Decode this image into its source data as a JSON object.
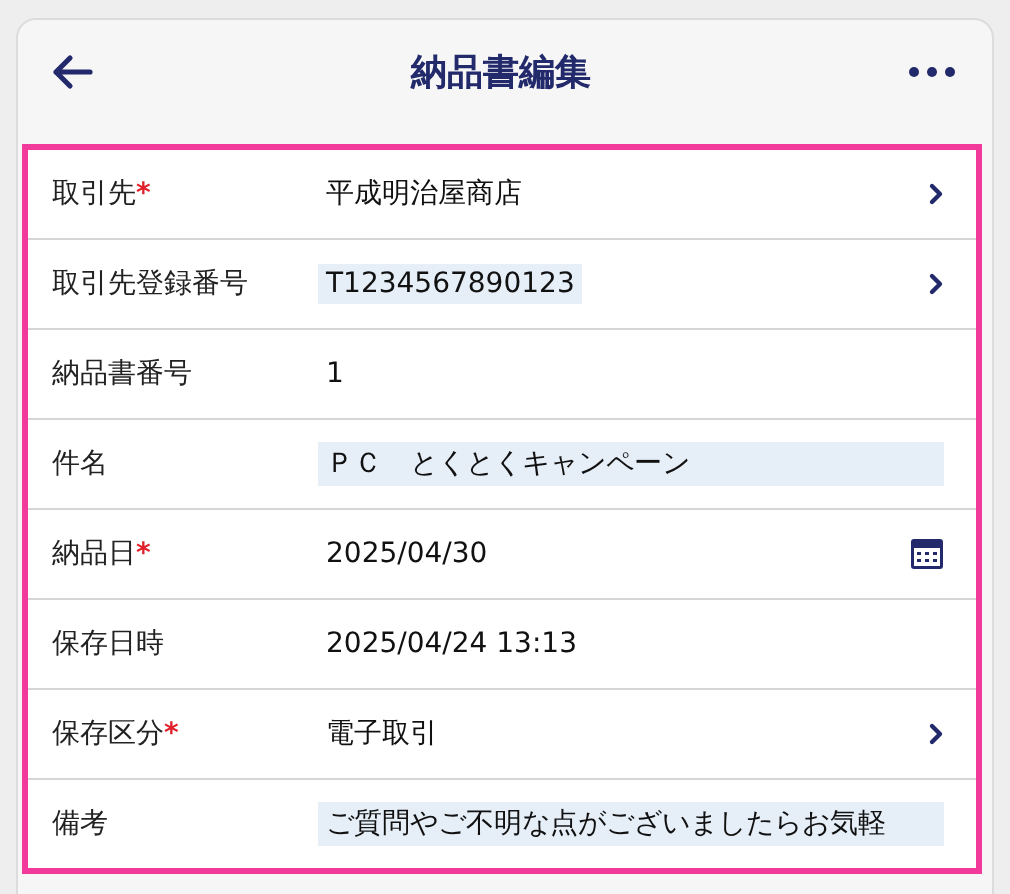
{
  "header": {
    "title": "納品書編集"
  },
  "fields": [
    {
      "label": "取引先",
      "mark": "*",
      "value": "平成明治屋商店",
      "highlighted": false,
      "kind": "select"
    },
    {
      "label": "取引先登録番号",
      "value": "T1234567890123",
      "highlighted": true,
      "kind": "select"
    },
    {
      "label": "納品書番号",
      "value": "1",
      "highlighted": false,
      "kind": "text"
    },
    {
      "label": "件名",
      "value": "ＰＣ　とくとくキャンペーン",
      "highlighted": true,
      "kind": "input"
    },
    {
      "label": "納品日",
      "mark": "*",
      "value": "2025/04/30",
      "highlighted": false,
      "kind": "date"
    },
    {
      "label": "保存日時",
      "value": "2025/04/24 13:13",
      "highlighted": false,
      "kind": "text"
    },
    {
      "label": "保存区分",
      "mark": "*",
      "value": "電子取引",
      "highlighted": false,
      "kind": "select"
    },
    {
      "label": "備考",
      "value": "ご質問やご不明な点がございましたらお気軽",
      "highlighted": true,
      "kind": "input"
    }
  ]
}
